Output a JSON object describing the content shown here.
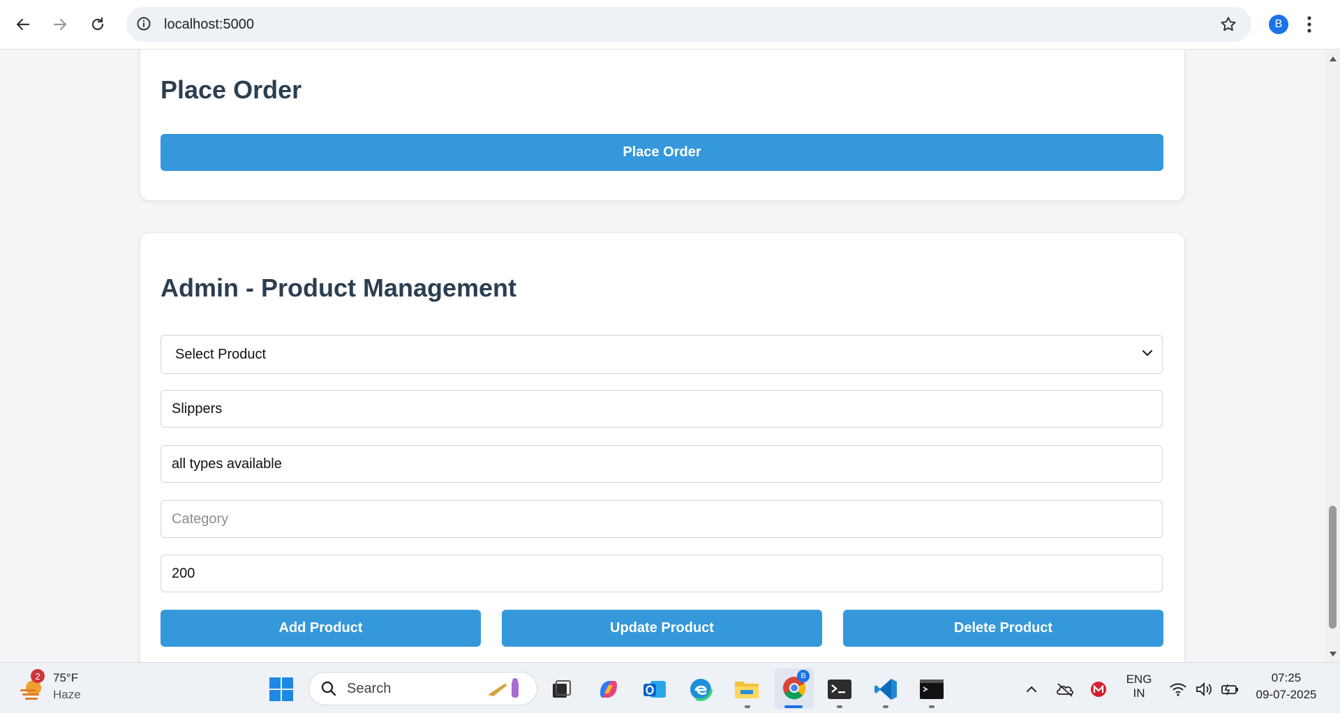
{
  "browser": {
    "url": "localhost:5000",
    "profile_initial": "B"
  },
  "order_section": {
    "title": "Place Order",
    "button_label": "Place Order"
  },
  "admin_section": {
    "title": "Admin - Product Management",
    "select_value": "Select Product",
    "name_value": "Slippers",
    "description_value": "all types available",
    "category_placeholder": "Category",
    "price_value": "200",
    "add_label": "Add Product",
    "update_label": "Update Product",
    "delete_label": "Delete Product"
  },
  "colors": {
    "accent": "#3498db",
    "heading": "#2c3e50"
  },
  "taskbar": {
    "weather_temp": "75°F",
    "weather_cond": "Haze",
    "weather_badge": "2",
    "search_label": "Search",
    "lang_line1": "ENG",
    "lang_line2": "IN",
    "time": "07:25",
    "date": "09-07-2025",
    "chrome_badge": "B"
  }
}
